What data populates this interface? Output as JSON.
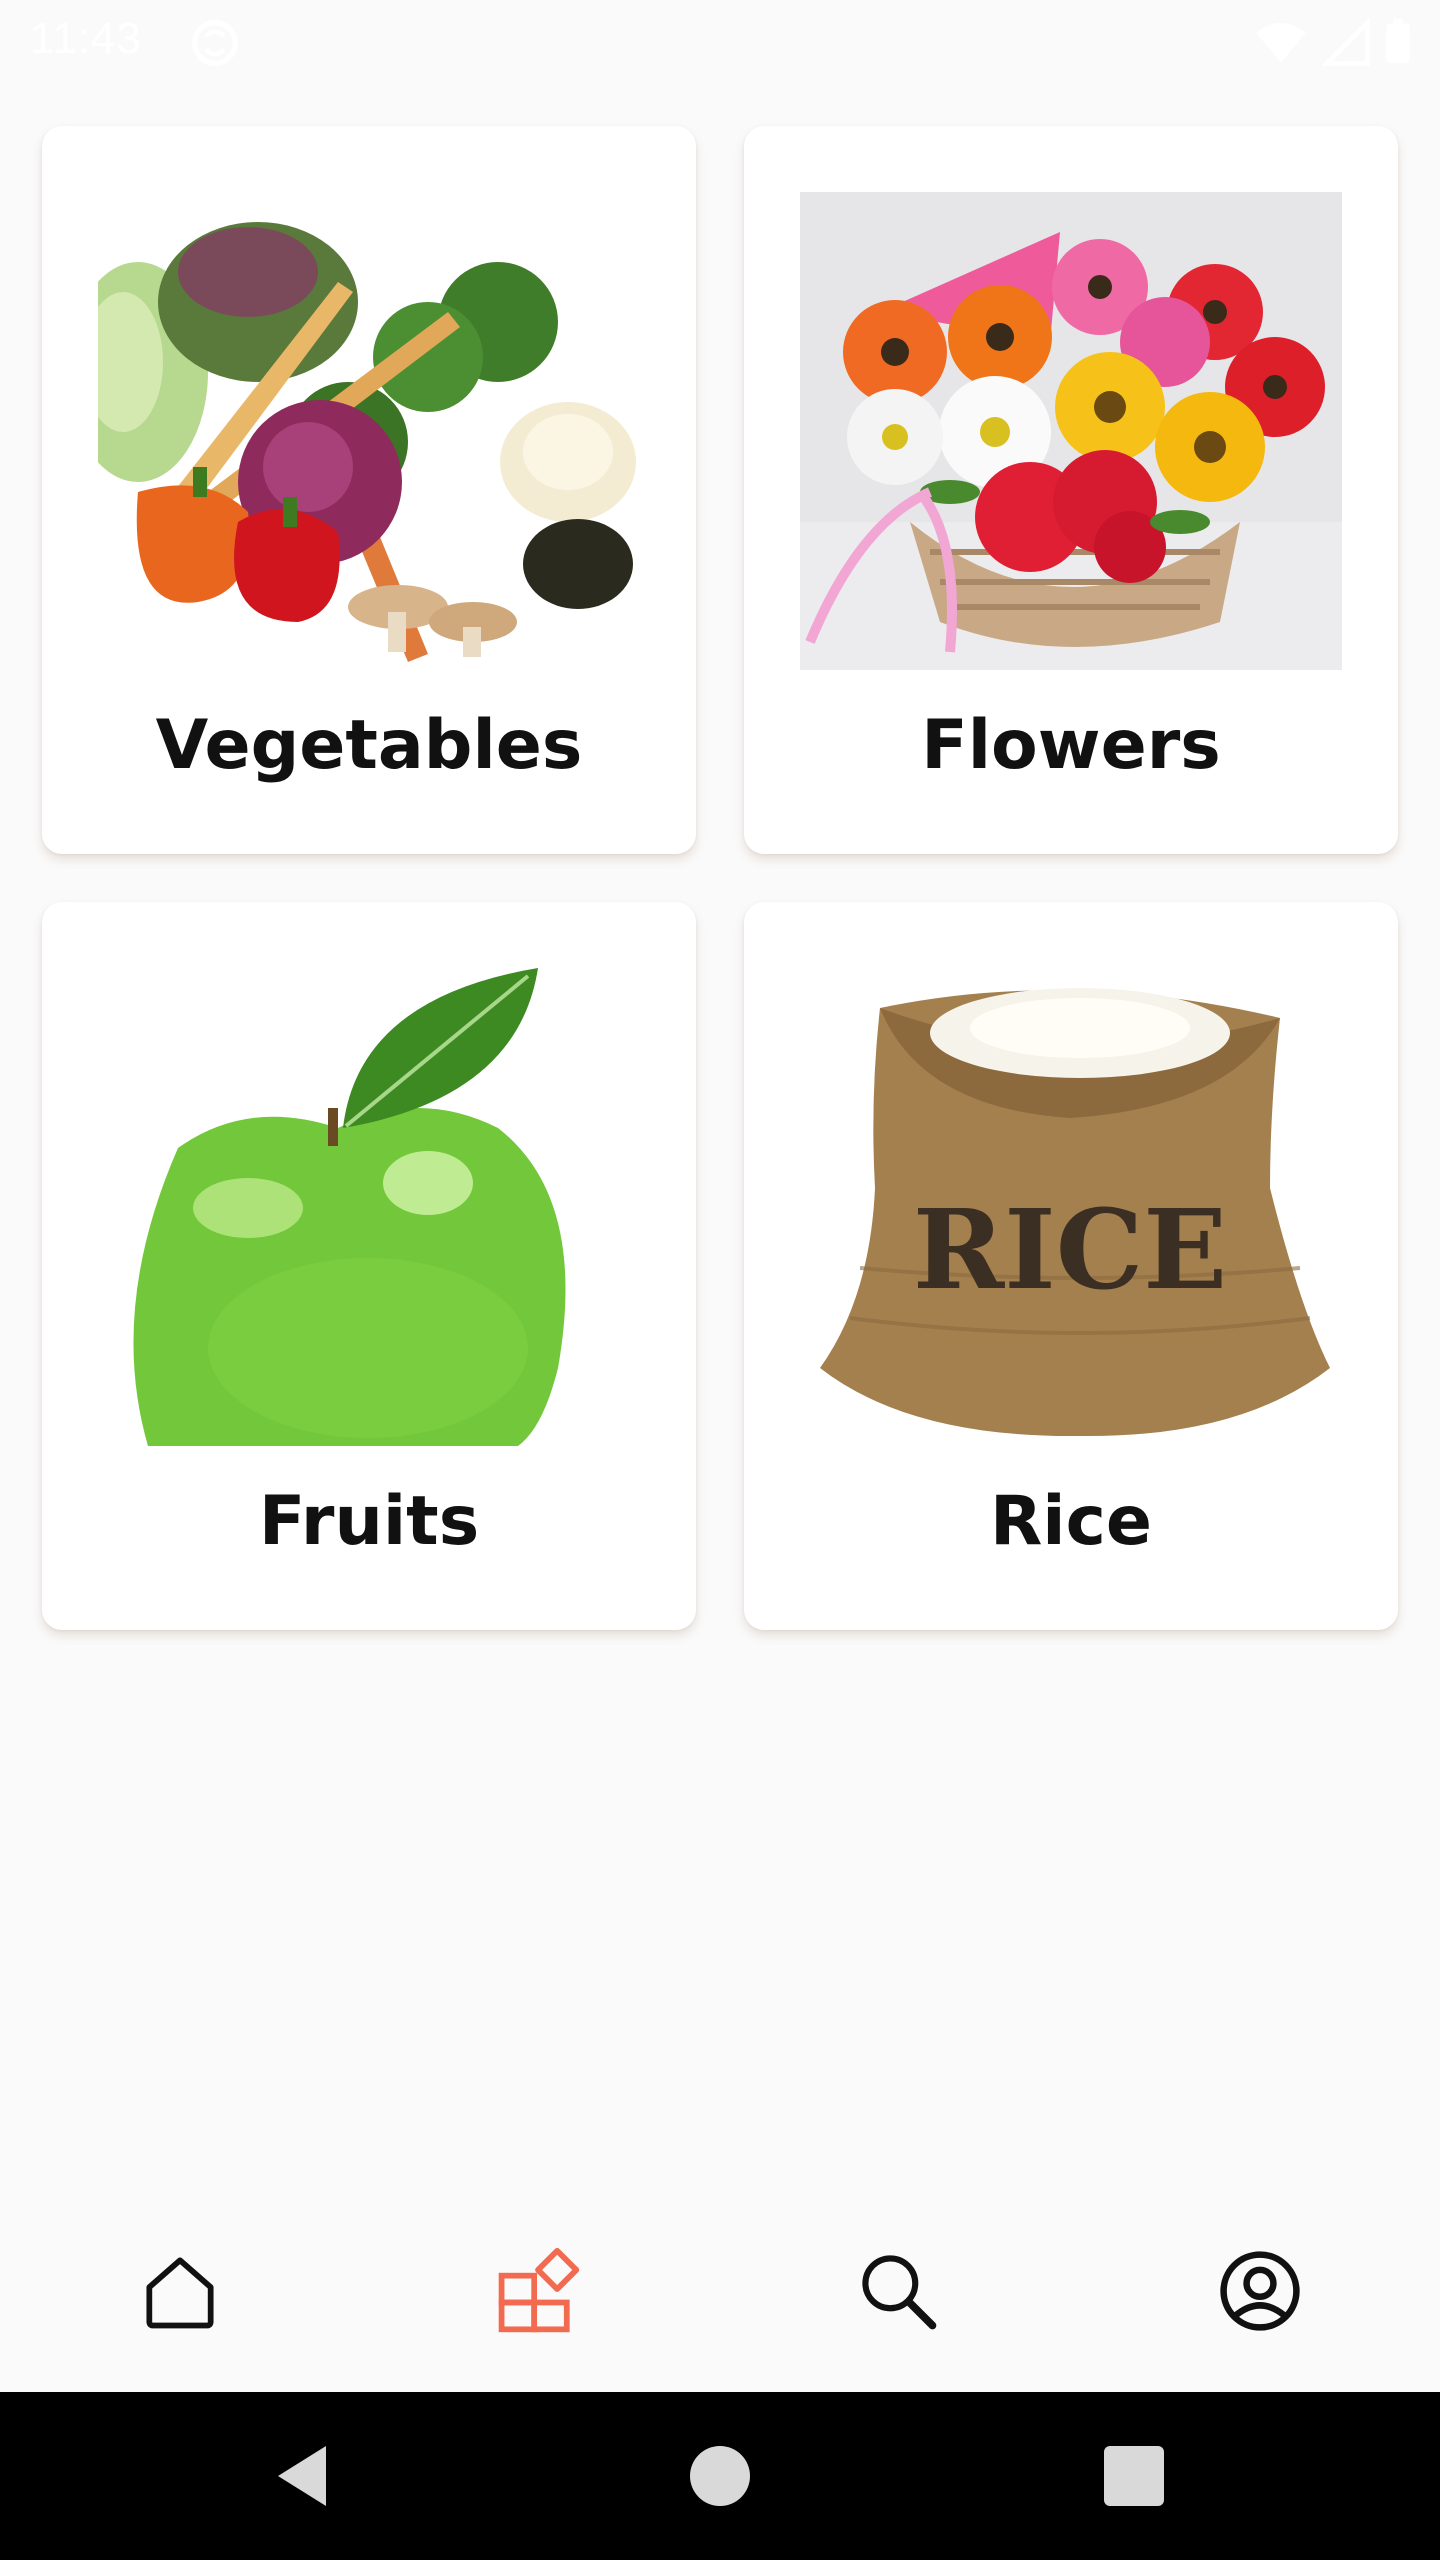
{
  "status_bar": {
    "time": "11:43",
    "icons": [
      "sync-icon",
      "wifi-icon",
      "signal-icon",
      "battery-icon"
    ]
  },
  "categories": [
    {
      "label": "Vegetables",
      "image": "vegetables-image"
    },
    {
      "label": "Flowers",
      "image": "flowers-image"
    },
    {
      "label": "Fruits",
      "image": "fruits-image"
    },
    {
      "label": "Rice",
      "image": "rice-image",
      "image_text": "RICE"
    }
  ],
  "bottom_nav": {
    "items": [
      {
        "icon": "home-icon",
        "active": false
      },
      {
        "icon": "categories-icon",
        "active": true
      },
      {
        "icon": "search-icon",
        "active": false
      },
      {
        "icon": "profile-icon",
        "active": false
      }
    ],
    "active_color": "#f26b50",
    "inactive_color": "#111111"
  },
  "system_nav": [
    "back-icon",
    "home-circle-icon",
    "recents-icon"
  ]
}
